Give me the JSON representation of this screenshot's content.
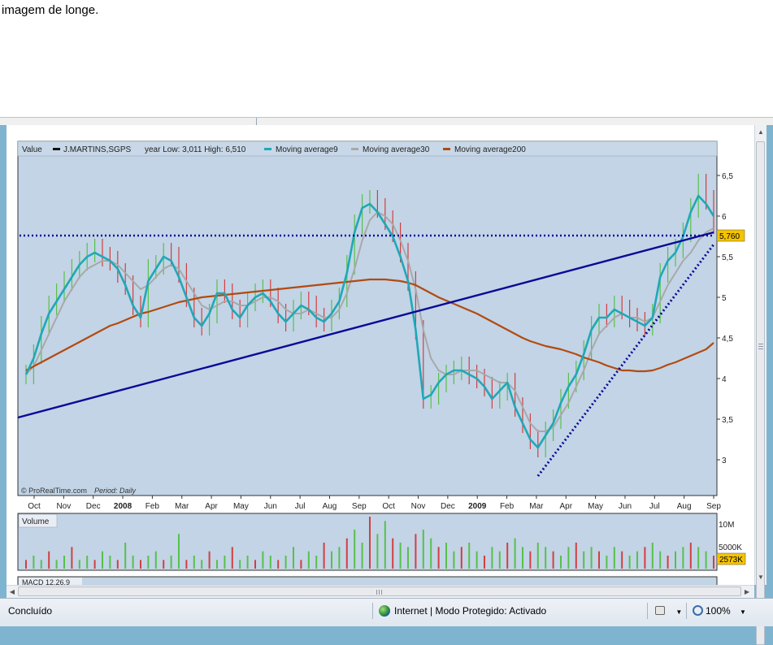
{
  "page": {
    "top_text": "imagem de longe."
  },
  "chart_data": {
    "type": "line",
    "legend": {
      "value_label": "Value",
      "ticker": "J.MARTINS,SGPS",
      "year_range": "year Low: 3,011  High: 6,510",
      "ma9": "Moving average9",
      "ma30": "Moving average30",
      "ma200": "Moving average200"
    },
    "credit": "© ProRealTime.com",
    "period": "Period: Daily",
    "x_labels": [
      "Oct",
      "Nov",
      "Dec",
      "2008",
      "Feb",
      "Mar",
      "Apr",
      "May",
      "Jun",
      "Jul",
      "Aug",
      "Sep",
      "Oct",
      "Nov",
      "Dec",
      "2009",
      "Feb",
      "Mar",
      "Apr",
      "May",
      "Jun",
      "Jul",
      "Aug",
      "Sep"
    ],
    "y_ticks": [
      "6,5",
      "6",
      "5,5",
      "5",
      "4,5",
      "4",
      "3,5",
      "3"
    ],
    "y_tick_values": [
      6.5,
      6,
      5.5,
      5,
      4.5,
      4,
      3.5,
      3
    ],
    "ylim": [
      2.7,
      6.7
    ],
    "last_value": "5,760",
    "last_value_num": 5.76,
    "horizontal_line": 5.76,
    "colors": {
      "price": "#58c04a",
      "price_down": "#d04040",
      "ma9": "#1fa8b8",
      "ma30": "#a8a8a8",
      "ma200": "#b34a10",
      "trend": "#0a0a96",
      "panel_bg": "#c2d4e6",
      "last_bg": "#f5c400"
    },
    "close": [
      4.05,
      4.3,
      4.65,
      4.9,
      5.05,
      5.2,
      5.35,
      5.45,
      5.55,
      5.6,
      5.5,
      5.45,
      5.3,
      5.15,
      4.9,
      4.75,
      5.35,
      5.4,
      5.55,
      5.5,
      5.3,
      5.0,
      4.75,
      4.65,
      4.8,
      5.1,
      5.05,
      4.85,
      4.75,
      4.95,
      5.05,
      5.1,
      5.0,
      4.8,
      4.7,
      4.85,
      4.95,
      4.9,
      4.75,
      4.7,
      4.85,
      5.0,
      5.4,
      5.9,
      6.15,
      6.2,
      6.1,
      5.95,
      5.8,
      5.55,
      5.2,
      4.6,
      3.75,
      3.8,
      3.95,
      4.05,
      4.1,
      4.15,
      4.05,
      4.0,
      3.9,
      3.75,
      3.85,
      3.95,
      3.65,
      3.45,
      3.25,
      3.15,
      3.35,
      3.5,
      3.75,
      3.95,
      4.1,
      4.35,
      4.65,
      4.8,
      4.75,
      4.9,
      4.85,
      4.75,
      4.7,
      4.65,
      4.8,
      5.3,
      5.5,
      5.6,
      5.8,
      6.1,
      6.4,
      6.2,
      5.9
    ],
    "ma9": [
      4.05,
      4.25,
      4.55,
      4.8,
      4.95,
      5.1,
      5.25,
      5.4,
      5.5,
      5.55,
      5.5,
      5.45,
      5.35,
      5.15,
      4.9,
      4.75,
      5.2,
      5.35,
      5.5,
      5.45,
      5.25,
      5.0,
      4.75,
      4.65,
      4.8,
      5.05,
      5.05,
      4.85,
      4.75,
      4.9,
      5.0,
      5.05,
      4.95,
      4.8,
      4.7,
      4.8,
      4.9,
      4.85,
      4.75,
      4.7,
      4.8,
      4.95,
      5.3,
      5.8,
      6.1,
      6.15,
      6.05,
      5.9,
      5.75,
      5.5,
      5.2,
      4.6,
      3.75,
      3.8,
      3.95,
      4.05,
      4.1,
      4.1,
      4.05,
      4.0,
      3.9,
      3.75,
      3.85,
      3.95,
      3.65,
      3.45,
      3.25,
      3.15,
      3.3,
      3.45,
      3.7,
      3.9,
      4.05,
      4.3,
      4.6,
      4.75,
      4.75,
      4.85,
      4.8,
      4.75,
      4.7,
      4.65,
      4.75,
      5.25,
      5.45,
      5.55,
      5.75,
      6.05,
      6.25,
      6.15,
      6.0
    ],
    "ma30": [
      4.05,
      4.15,
      4.35,
      4.55,
      4.75,
      4.95,
      5.1,
      5.25,
      5.35,
      5.4,
      5.45,
      5.45,
      5.4,
      5.3,
      5.2,
      5.1,
      5.15,
      5.25,
      5.35,
      5.4,
      5.35,
      5.2,
      5.05,
      4.9,
      4.85,
      4.9,
      4.95,
      4.95,
      4.9,
      4.9,
      4.95,
      5.0,
      5.0,
      4.95,
      4.85,
      4.8,
      4.8,
      4.85,
      4.8,
      4.75,
      4.75,
      4.85,
      5.05,
      5.35,
      5.7,
      5.95,
      6.05,
      6.0,
      5.9,
      5.7,
      5.45,
      5.1,
      4.6,
      4.25,
      4.1,
      4.05,
      4.05,
      4.1,
      4.1,
      4.1,
      4.05,
      4.0,
      3.95,
      3.95,
      3.85,
      3.65,
      3.45,
      3.35,
      3.35,
      3.4,
      3.55,
      3.7,
      3.9,
      4.1,
      4.35,
      4.55,
      4.65,
      4.75,
      4.8,
      4.75,
      4.75,
      4.7,
      4.75,
      4.95,
      5.15,
      5.3,
      5.45,
      5.55,
      5.7,
      5.8,
      5.85
    ],
    "ma200": [
      4.1,
      4.15,
      4.2,
      4.25,
      4.3,
      4.35,
      4.4,
      4.45,
      4.5,
      4.55,
      4.6,
      4.65,
      4.68,
      4.72,
      4.76,
      4.8,
      4.82,
      4.85,
      4.88,
      4.91,
      4.94,
      4.96,
      4.98,
      5.0,
      5.01,
      5.02,
      5.03,
      5.04,
      5.05,
      5.06,
      5.07,
      5.08,
      5.09,
      5.1,
      5.11,
      5.12,
      5.13,
      5.14,
      5.15,
      5.16,
      5.17,
      5.18,
      5.19,
      5.2,
      5.21,
      5.22,
      5.22,
      5.22,
      5.21,
      5.2,
      5.18,
      5.15,
      5.1,
      5.05,
      5.0,
      4.96,
      4.92,
      4.88,
      4.84,
      4.8,
      4.75,
      4.7,
      4.65,
      4.6,
      4.55,
      4.5,
      4.46,
      4.43,
      4.4,
      4.38,
      4.36,
      4.33,
      4.3,
      4.26,
      4.23,
      4.2,
      4.16,
      4.13,
      4.1,
      4.1,
      4.09,
      4.09,
      4.1,
      4.13,
      4.17,
      4.2,
      4.24,
      4.28,
      4.32,
      4.36,
      4.44
    ],
    "trendlines": [
      {
        "style": "solid",
        "from": [
          0,
          3.52
        ],
        "to": [
          90,
          5.8
        ]
      },
      {
        "style": "dotted",
        "from": [
          67,
          2.8
        ],
        "to": [
          90,
          5.65
        ]
      }
    ],
    "volume": {
      "label": "Volume",
      "ticks": [
        "10M",
        "5000K"
      ],
      "last": "2573K",
      "values": [
        2,
        3,
        2,
        4,
        2,
        3,
        5,
        2,
        3,
        2,
        4,
        3,
        2,
        6,
        3,
        2,
        3,
        4,
        2,
        3,
        8,
        2,
        3,
        2,
        4,
        2,
        3,
        5,
        2,
        3,
        2,
        4,
        3,
        2,
        3,
        5,
        2,
        4,
        3,
        6,
        4,
        5,
        7,
        9,
        6,
        12,
        8,
        11,
        7,
        6,
        5,
        8,
        9,
        7,
        5,
        6,
        4,
        5,
        6,
        4,
        3,
        5,
        4,
        6,
        7,
        5,
        4,
        6,
        5,
        4,
        3,
        5,
        6,
        4,
        5,
        4,
        3,
        5,
        4,
        3,
        4,
        5,
        6,
        4,
        3,
        4,
        5,
        6,
        5,
        4,
        3
      ],
      "ylim": [
        0,
        12
      ]
    },
    "macd_label": "MACD 12,26,9"
  },
  "status": {
    "left": "Concluído",
    "zone": "Internet | Modo Protegido: Activado",
    "zoom": "100%",
    "dropdown_glyph": "▼"
  }
}
